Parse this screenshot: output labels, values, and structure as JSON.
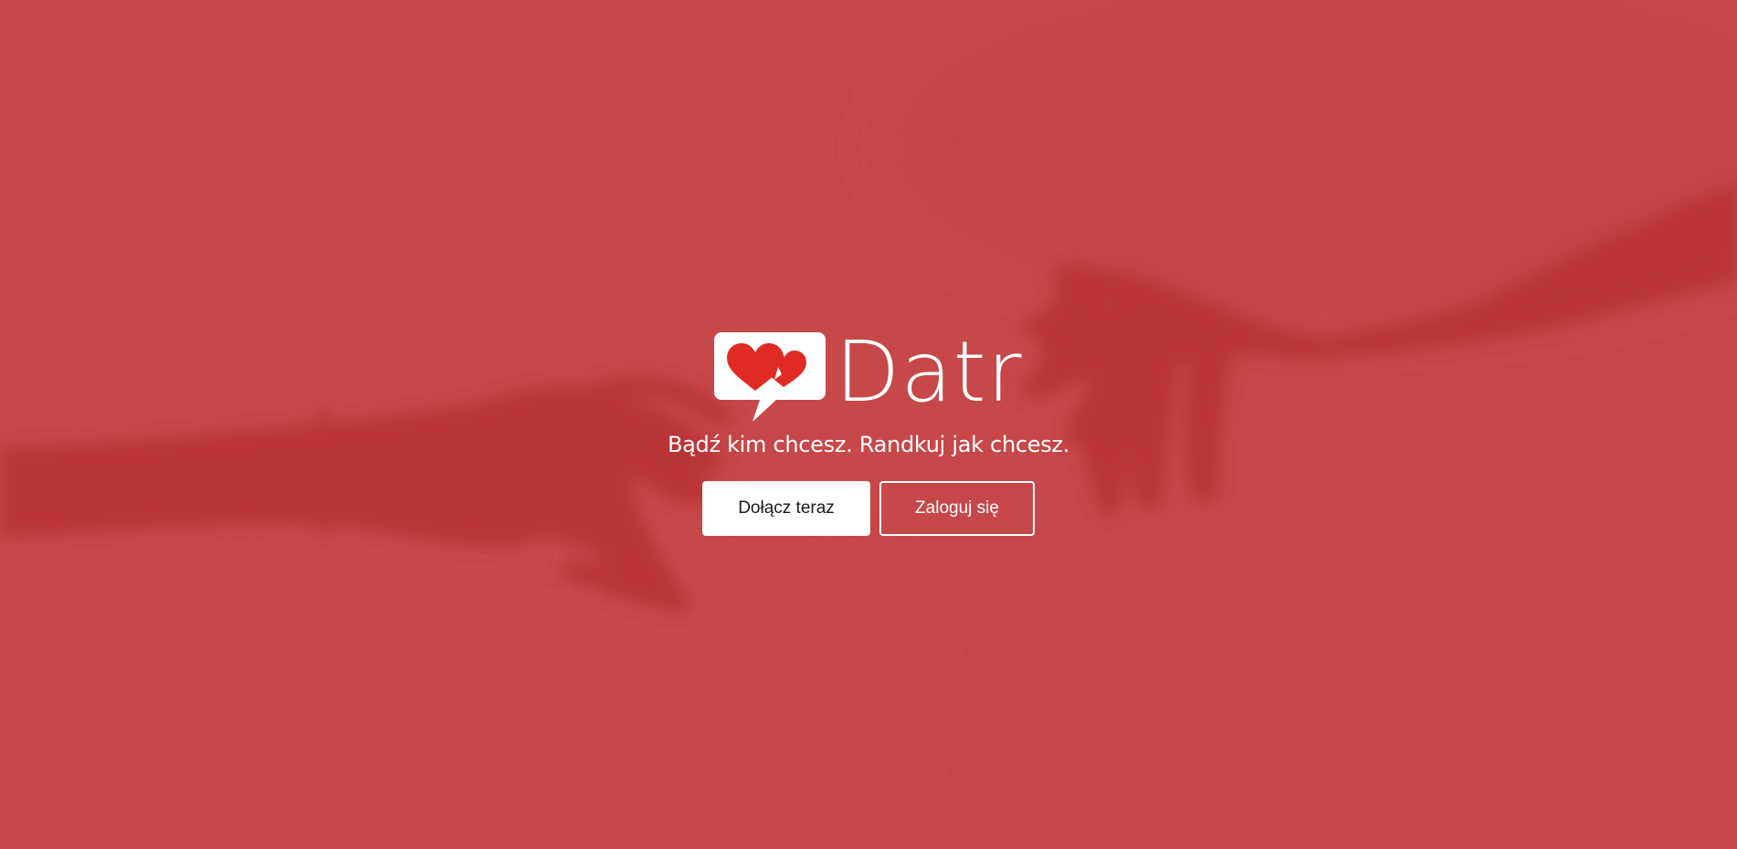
{
  "brand": {
    "name": "Datr",
    "logo_icon": "heart-speech-bubble-icon",
    "heart_color": "#e02a24"
  },
  "hero": {
    "background_color": "#c64849",
    "background_image": "reaching-hands-photo",
    "tagline": "Bądź kim chcesz. Randkuj jak chcesz."
  },
  "actions": {
    "join_label": "Dołącz teraz",
    "login_label": "Zaloguj się"
  }
}
